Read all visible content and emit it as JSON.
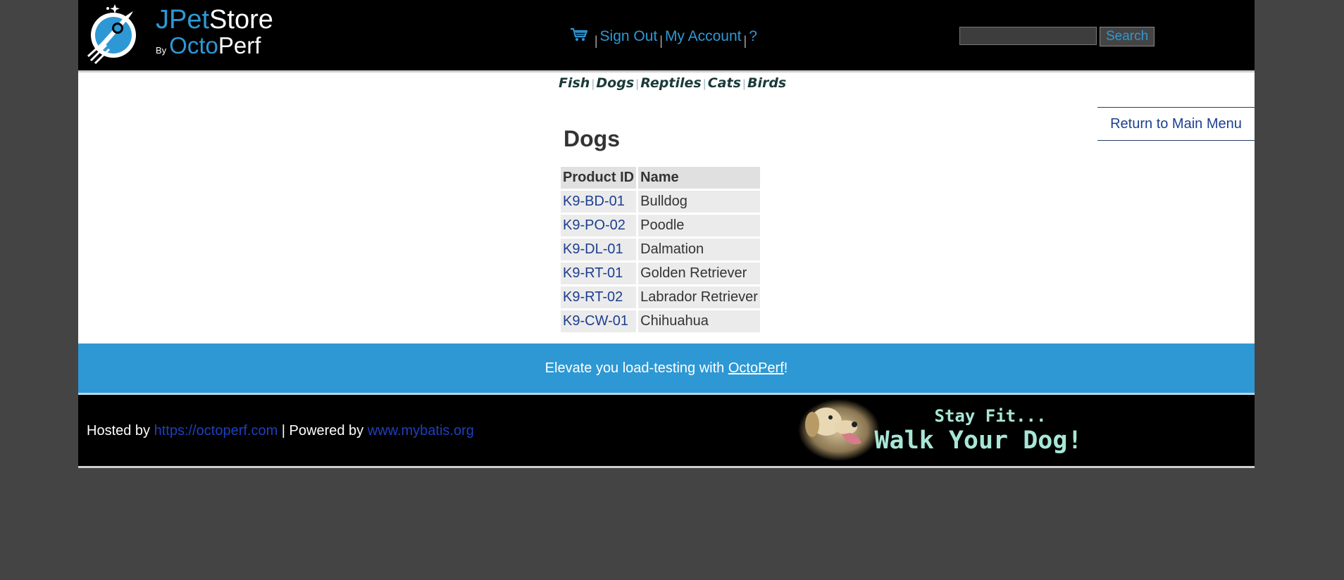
{
  "header": {
    "logo": {
      "jpet": "JPet",
      "store": "Store",
      "by": "By",
      "octo": "Octo",
      "perf": "Perf"
    },
    "menu": {
      "cart_icon": "shopping-cart-icon",
      "sign_out": "Sign Out",
      "my_account": "My Account",
      "help": "?",
      "separator": "|"
    },
    "search": {
      "value": "",
      "button_label": "Search"
    }
  },
  "quick_links": [
    {
      "label": "Fish"
    },
    {
      "label": "Dogs"
    },
    {
      "label": "Reptiles"
    },
    {
      "label": "Cats"
    },
    {
      "label": "Birds"
    }
  ],
  "quick_link_separator": "|",
  "content": {
    "return_link": "Return to Main Menu",
    "category_title": "Dogs",
    "table": {
      "headers": [
        "Product ID",
        "Name"
      ],
      "rows": [
        {
          "id": "K9-BD-01",
          "name": "Bulldog"
        },
        {
          "id": "K9-PO-02",
          "name": "Poodle"
        },
        {
          "id": "K9-DL-01",
          "name": "Dalmation"
        },
        {
          "id": "K9-RT-01",
          "name": "Golden Retriever"
        },
        {
          "id": "K9-RT-02",
          "name": "Labrador Retriever"
        },
        {
          "id": "K9-CW-01",
          "name": "Chihuahua"
        }
      ]
    }
  },
  "footer": {
    "banner": {
      "prefix": "Elevate you load-testing with ",
      "link": "OctoPerf",
      "suffix": "!"
    },
    "hosted_by": "Hosted by ",
    "hosted_link": "https://octoperf.com",
    "powered_by": " | Powered by ",
    "powered_link": "www.mybatis.org",
    "ad": {
      "line1": "Stay Fit...",
      "line2": "Walk Your Dog!"
    }
  },
  "colors": {
    "accent_blue": "#2e98d4",
    "link_dark_blue": "#1d3f8f",
    "header_bg": "#000000",
    "page_bg": "#444444"
  }
}
